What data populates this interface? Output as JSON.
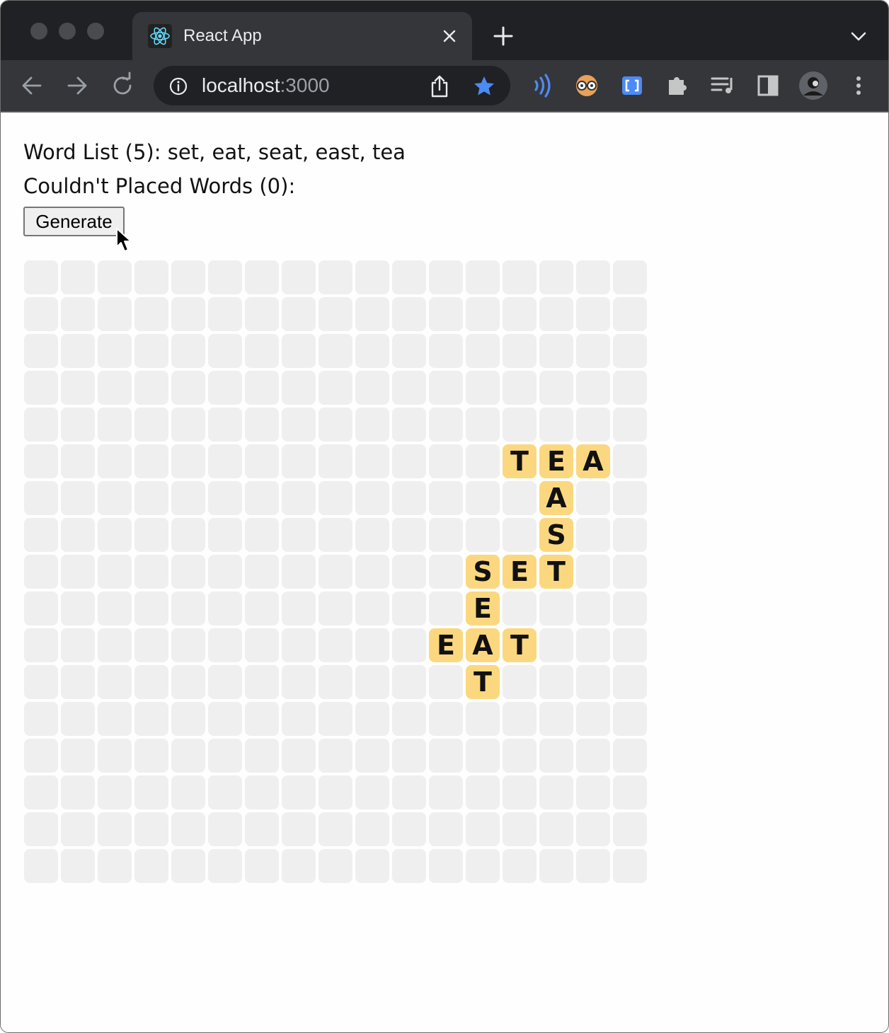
{
  "browser": {
    "tab": {
      "title": "React App",
      "icon": "react-logo-icon"
    },
    "address": {
      "host": "localhost",
      "port": ":3000"
    },
    "colors": {
      "frame": "#202124",
      "toolbar": "#35363a",
      "accent": "#4c8bf5"
    }
  },
  "page": {
    "word_list_line": "Word List (5): set, eat, seat, east, tea",
    "unplaced_line": "Couldn't Placed Words (0):",
    "generate_label": "Generate",
    "tile_color": "#fbd87f",
    "empty_color": "#efefef",
    "grid_size": 17,
    "grid": [
      "",
      "",
      "",
      "",
      "",
      "             TEA ",
      "              A  ",
      "              S  ",
      "            SET  ",
      "            E    ",
      "           EAT   ",
      "            T    ",
      "",
      "",
      "",
      "",
      ""
    ]
  }
}
